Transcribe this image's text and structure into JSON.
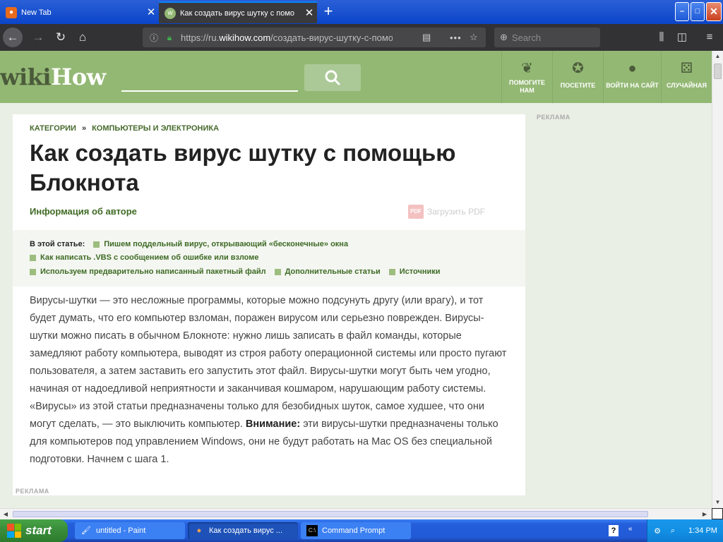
{
  "browser": {
    "tabs": [
      {
        "label": "New Tab",
        "active": false,
        "icon": "firefox-icon"
      },
      {
        "label": "Как создать вирус шутку с помо",
        "active": true,
        "icon": "wikihow-favicon"
      }
    ],
    "new_tab_symbol": "+",
    "url_prefix": "https://ru.",
    "url_domain": "wikihow.com",
    "url_path": "/создать-вирус-шутку-с-помо",
    "search_placeholder": "Search",
    "window_buttons": {
      "minimize": "–",
      "maximize": "□",
      "close": "✕"
    }
  },
  "site": {
    "logo_part1": "wiki",
    "logo_part2": "How",
    "nav": [
      {
        "label": "ПОМОГИТЕ НАМ",
        "icon": "sprout-icon"
      },
      {
        "label": "ПОСЕТИТЕ",
        "icon": "compass-icon"
      },
      {
        "label": "ВОЙТИ НА САЙТ",
        "icon": "user-icon"
      },
      {
        "label": "СЛУЧАЙНАЯ",
        "icon": "dice-icon"
      }
    ],
    "ad_label": "РЕКЛАМА"
  },
  "article": {
    "breadcrumb": {
      "cat": "КАТЕГОРИИ",
      "sep": "»",
      "sub": "КОМПЬЮТЕРЫ И ЭЛЕКТРОНИКА"
    },
    "title": "Как создать вирус шутку с помощью Блокнота",
    "author_link": "Информация об авторе",
    "pdf_label": "Загрузить PDF",
    "pdf_icon_text": "PDF",
    "toc_lead": "В этой статье:",
    "toc": [
      "Пишем поддельный вирус, открывающий «бесконечные» окна",
      "Как написать .VBS с сообщением об ошибке или взломе",
      "Используем предварительно написанный пакетный файл",
      "Дополнительные статьи",
      "Источники"
    ],
    "intro": "Вирусы-шутки — это несложные программы, которые можно подсунуть другу (или врагу), и тот будет думать, что его компьютер взломан, поражен вирусом или серьезно поврежден. Вирусы-шутки можно писать в обычном Блокноте: нужно лишь записать в файл команды, которые замедляют работу компьютера, выводят из строя работу операционной системы или просто пугают пользователя, а затем заставить его запустить этот файл. Вирусы-шутки могут быть чем угодно, начиная от надоедливой неприятности и заканчивая кошмаром, нарушающим работу системы. «Вирусы» из этой статьи предназначены только для безобидных шуток, самое худшее, что они могут сделать, — это выключить компьютер.",
    "warning_label": "Внимание:",
    "warning_text": " эти вирусы-шутки предназначены только для компьютеров под управлением Windows, они не будут работать на Mac OS без специальной подготовки. Начнем с шага 1.",
    "ad_label": "РЕКЛАМА"
  },
  "taskbar": {
    "start_label": "start",
    "items": [
      {
        "label": "untitled - Paint",
        "active": false
      },
      {
        "label": "Как создать вирус ...",
        "active": true
      },
      {
        "label": "Command Prompt",
        "active": false
      }
    ],
    "clock": "1:34 PM"
  },
  "colors": {
    "wikihow_green": "#93b874",
    "link_green": "#3f6b25",
    "xp_blue": "#245edb"
  }
}
